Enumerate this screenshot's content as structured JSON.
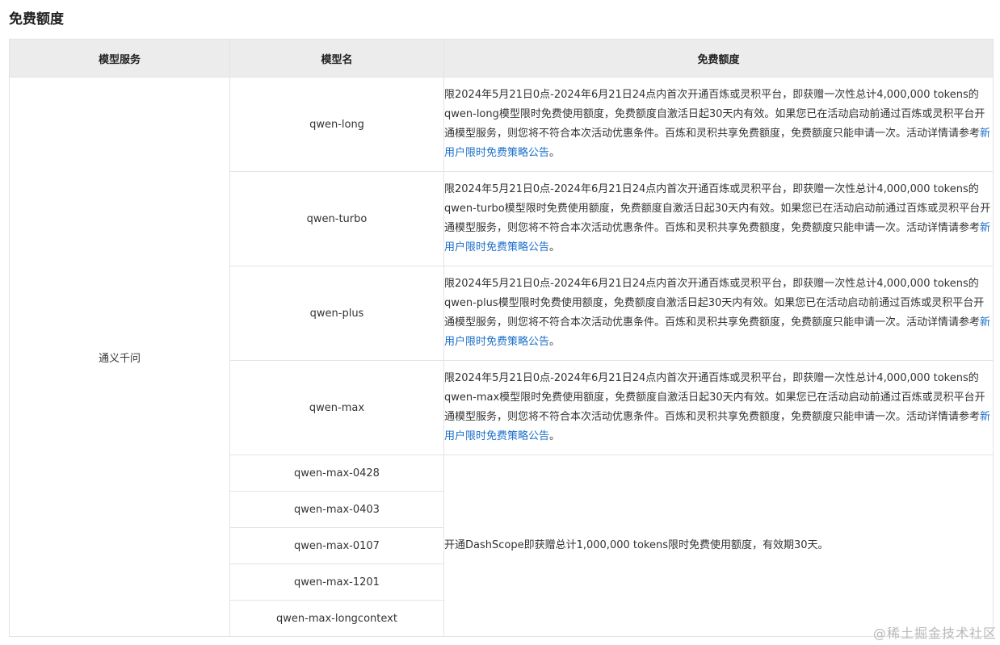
{
  "section_title": "免费额度",
  "table": {
    "headers": [
      "模型服务",
      "模型名",
      "免费额度"
    ],
    "service": "通义千问",
    "rows_with_desc": [
      {
        "model": "qwen-long",
        "desc": "限2024年5月21日0点-2024年6月21日24点内首次开通百炼或灵积平台，即获赠一次性总计4,000,000 tokens的qwen-long模型限时免费使用额度，免费额度自激活日起30天内有效。如果您已在活动启动前通过百炼或灵积平台开通模型服务，则您将不符合本次活动优惠条件。百炼和灵积共享免费额度，免费额度只能申请一次。活动详情请参考",
        "link": "新用户限时免费策略公告",
        "tail": "。"
      },
      {
        "model": "qwen-turbo",
        "desc": "限2024年5月21日0点-2024年6月21日24点内首次开通百炼或灵积平台，即获赠一次性总计4,000,000 tokens的qwen-turbo模型限时免费使用额度，免费额度自激活日起30天内有效。如果您已在活动启动前通过百炼或灵积平台开通模型服务，则您将不符合本次活动优惠条件。百炼和灵积共享免费额度，免费额度只能申请一次。活动详情请参考",
        "link": "新用户限时免费策略公告",
        "tail": "。"
      },
      {
        "model": "qwen-plus",
        "desc": "限2024年5月21日0点-2024年6月21日24点内首次开通百炼或灵积平台，即获赠一次性总计4,000,000 tokens的qwen-plus模型限时免费使用额度，免费额度自激活日起30天内有效。如果您已在活动启动前通过百炼或灵积平台开通模型服务，则您将不符合本次活动优惠条件。百炼和灵积共享免费额度，免费额度只能申请一次。活动详情请参考",
        "link": "新用户限时免费策略公告",
        "tail": "。"
      },
      {
        "model": "qwen-max",
        "desc": "限2024年5月21日0点-2024年6月21日24点内首次开通百炼或灵积平台，即获赠一次性总计4,000,000 tokens的qwen-max模型限时免费使用额度，免费额度自激活日起30天内有效。如果您已在活动启动前通过百炼或灵积平台开通模型服务，则您将不符合本次活动优惠条件。百炼和灵积共享免费额度，免费额度只能申请一次。活动详情请参考",
        "link": "新用户限时免费策略公告",
        "tail": "。"
      }
    ],
    "shared_models": [
      "qwen-max-0428",
      "qwen-max-0403",
      "qwen-max-0107",
      "qwen-max-1201",
      "qwen-max-longcontext"
    ],
    "shared_desc": "开通DashScope即获赠总计1,000,000 tokens限时免费使用额度，有效期30天。"
  },
  "watermark": "@稀土掘金技术社区"
}
